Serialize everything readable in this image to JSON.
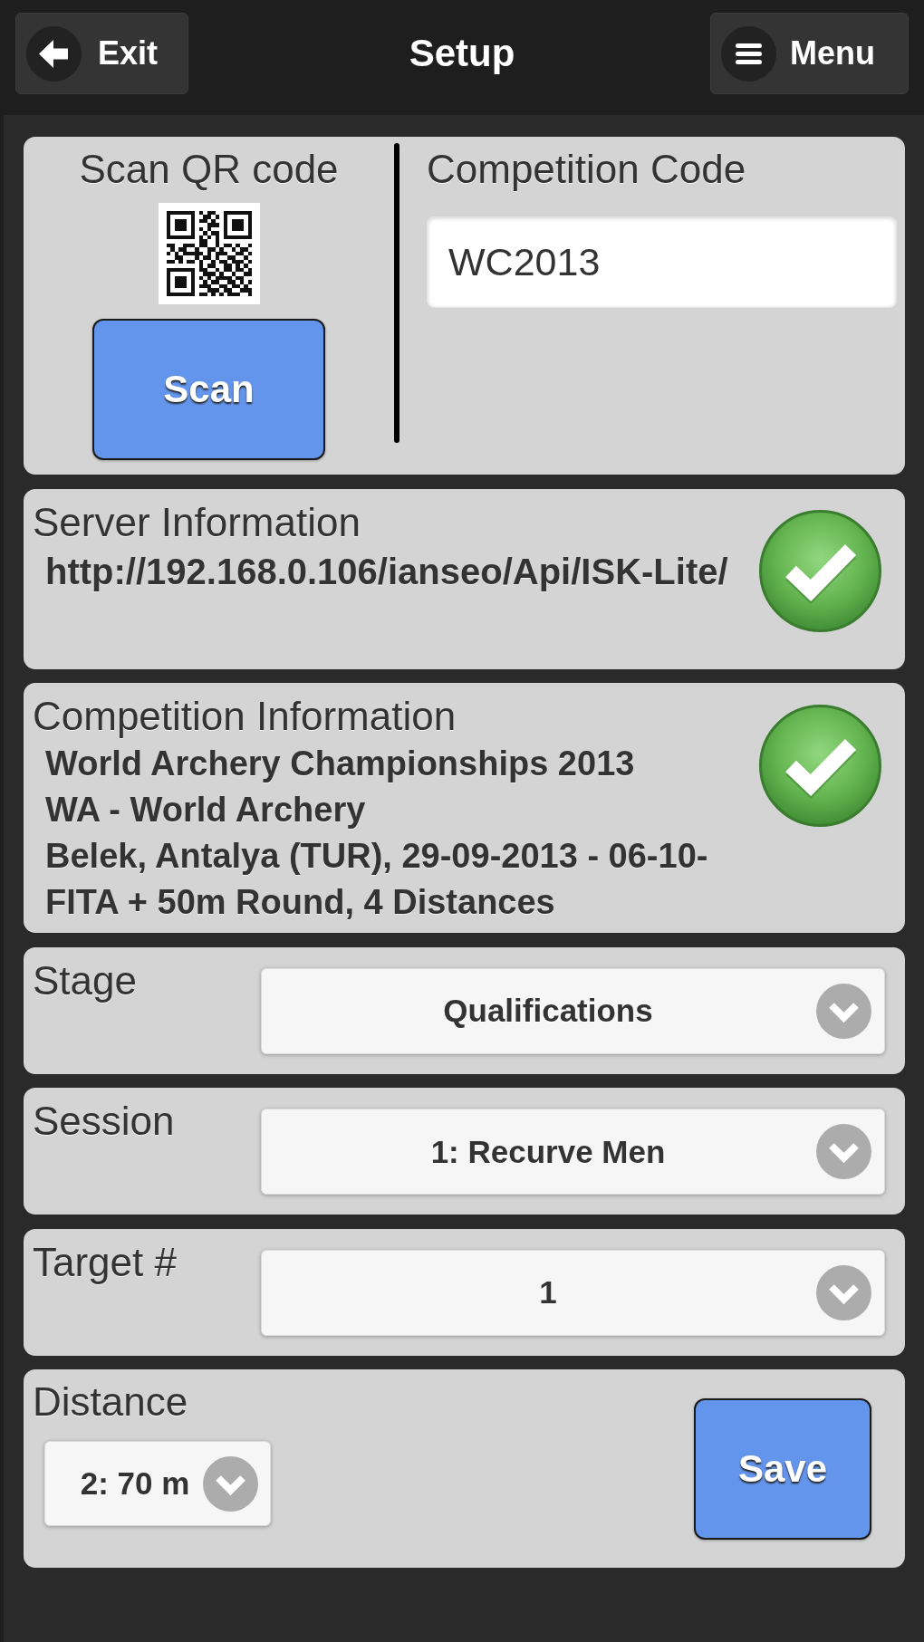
{
  "header": {
    "exit_button": "Exit",
    "title": "Setup",
    "menu_button": "Menu"
  },
  "scan": {
    "label": "Scan QR code",
    "button": "Scan"
  },
  "competition_code": {
    "label": "Competition Code",
    "value": "WC2013"
  },
  "server_information": {
    "label": "Server Information",
    "url": "http://192.168.0.106/ianseo/Api/ISK-Lite/",
    "verified": true
  },
  "competition_information": {
    "label": "Competition Information",
    "lines": [
      "World Archery Championships 2013",
      "WA - World Archery",
      "Belek, Antalya (TUR), 29-09-2013 - 06-10-",
      "FITA + 50m Round, 4 Distances"
    ],
    "verified": true
  },
  "selects": [
    {
      "label": "Stage",
      "value": "Qualifications"
    },
    {
      "label": "Session",
      "value": "1: Recurve Men"
    },
    {
      "label": "Target #",
      "value": "1"
    }
  ],
  "distance": {
    "label": "Distance",
    "value": "2: 70 m"
  },
  "save_button": "Save"
}
